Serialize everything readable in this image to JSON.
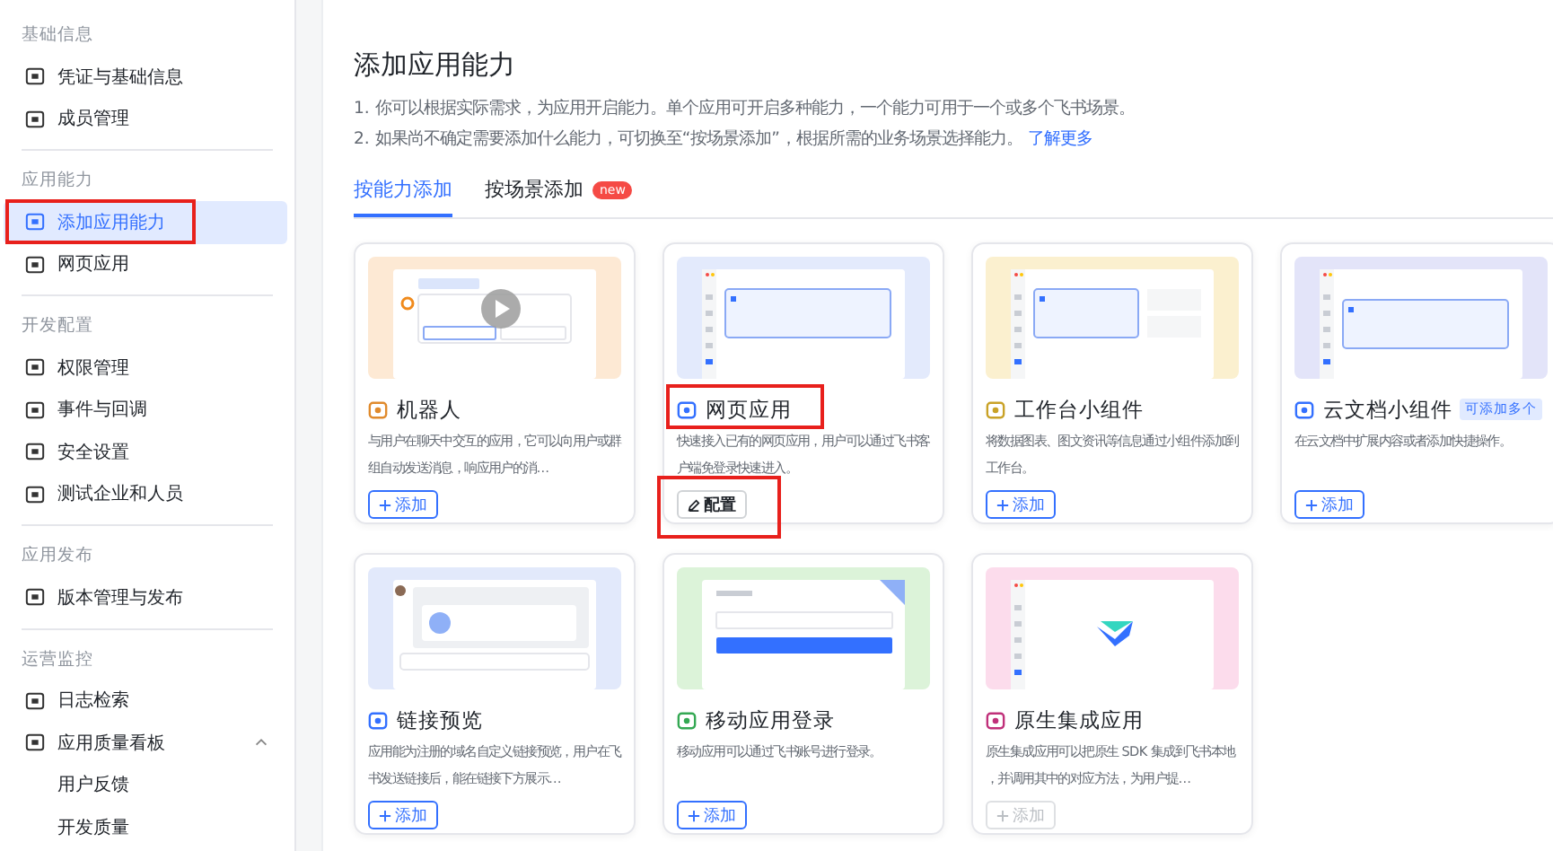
{
  "sidebar": {
    "groups": [
      {
        "heading": "基础信息",
        "items": [
          {
            "label": "凭证与基础信息",
            "selected": false,
            "highlighted": false
          },
          {
            "label": "成员管理",
            "selected": false,
            "highlighted": false
          }
        ]
      },
      {
        "heading": "应用能力",
        "items": [
          {
            "label": "添加应用能力",
            "selected": true,
            "highlighted": true
          },
          {
            "label": "网页应用",
            "selected": false,
            "highlighted": false
          }
        ]
      },
      {
        "heading": "开发配置",
        "items": [
          {
            "label": "权限管理",
            "selected": false,
            "highlighted": false
          },
          {
            "label": "事件与回调",
            "selected": false,
            "highlighted": false
          },
          {
            "label": "安全设置",
            "selected": false,
            "highlighted": false
          },
          {
            "label": "测试企业和人员",
            "selected": false,
            "highlighted": false
          }
        ]
      },
      {
        "heading": "应用发布",
        "items": [
          {
            "label": "版本管理与发布",
            "selected": false,
            "highlighted": false
          }
        ]
      },
      {
        "heading": "运营监控",
        "items": [
          {
            "label": "日志检索",
            "selected": false,
            "highlighted": false
          },
          {
            "label": "应用质量看板",
            "selected": false,
            "highlighted": false,
            "expanded": true,
            "children": [
              {
                "label": "用户反馈",
                "selected": false
              },
              {
                "label": "开发质量",
                "selected": false
              }
            ]
          }
        ]
      }
    ]
  },
  "main": {
    "title": "添加应用能力",
    "notes": [
      {
        "text": "1. 你可以根据实际需求，为应用开启能力。单个应用可开启多种能力，一个能力可用于一个或多个飞书场景。"
      },
      {
        "text": "2. 如果尚不确定需要添加什么能力，可切换至“按场景添加”，根据所需的业务场景选择能力。",
        "link": "了解更多"
      }
    ],
    "tabs": [
      {
        "label": "按能力添加",
        "selected": true
      },
      {
        "label": "按场景添加",
        "selected": false,
        "badge": "new"
      }
    ],
    "cards": [
      {
        "title": "机器人",
        "description": "与用户在聊天中交互的应用，它可以向用户或群组自动发送消息，响应用户的消…",
        "color": "#fde9d4",
        "title_highlighted": false,
        "button": {
          "kind": "add",
          "label": "添加",
          "disabled": false,
          "highlighted": false
        }
      },
      {
        "title": "网页应用",
        "description": "快速接入已有的网页应用，用户可以通过飞书客户端免登录快速进入。",
        "color": "#e3eafc",
        "title_highlighted": true,
        "button": {
          "kind": "configure",
          "label": "配置",
          "disabled": false,
          "highlighted": true
        }
      },
      {
        "title": "工作台小组件",
        "description": "将数据图表、图文资讯等信息通过小组件添加到工作台。",
        "color": "#fbf0cf",
        "title_highlighted": false,
        "button": {
          "kind": "add",
          "label": "添加",
          "disabled": false,
          "highlighted": false
        }
      },
      {
        "title": "云文档小组件",
        "tag": "可添加多个",
        "description": "在云文档中扩展内容或者添加快捷操作。",
        "color": "#e3e4f9",
        "title_highlighted": false,
        "button": {
          "kind": "add",
          "label": "添加",
          "disabled": false,
          "highlighted": false
        }
      },
      {
        "title": "链接预览",
        "description": "应用能为注册的域名自定义链接预览，用户在飞书发送链接后，能在链接下方展示…",
        "color": "#e2e9fb",
        "title_highlighted": false,
        "button": {
          "kind": "add",
          "label": "添加",
          "disabled": false,
          "highlighted": false
        }
      },
      {
        "title": "移动应用登录",
        "description": "移动应用可以通过飞书账号进行登录。",
        "color": "#dcf3d9",
        "title_highlighted": false,
        "button": {
          "kind": "add",
          "label": "添加",
          "disabled": false,
          "highlighted": false
        }
      },
      {
        "title": "原生集成应用",
        "description": "原生集成应用可以把原生 SDK 集成到飞书本地，并调用其中的对应方法，为用户提…",
        "color": "#fcdcec",
        "title_highlighted": false,
        "button": {
          "kind": "add",
          "label": "添加",
          "disabled": true,
          "highlighted": false
        }
      }
    ]
  }
}
